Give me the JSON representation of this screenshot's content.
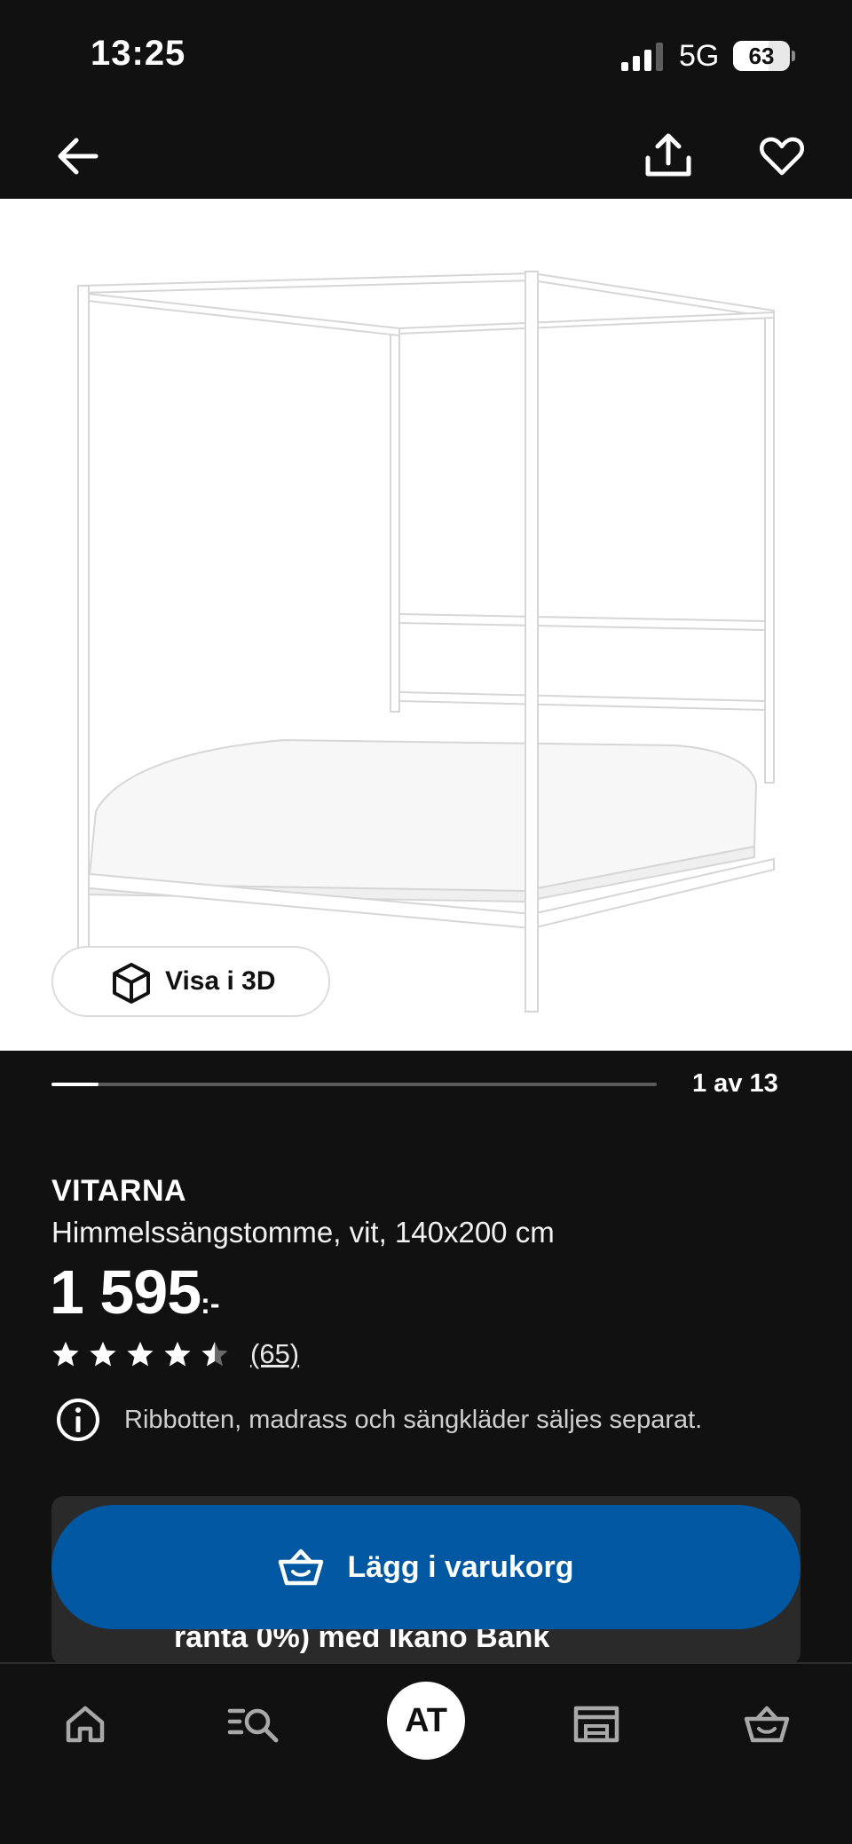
{
  "status_bar": {
    "time": "13:25",
    "network": "5G",
    "battery": "63",
    "battery_level": 0.63
  },
  "top_nav": {
    "back_icon": "arrow-left-icon",
    "share_icon": "share-icon",
    "favorite_icon": "heart-icon"
  },
  "gallery": {
    "view_3d_label": "Visa i 3D",
    "counter": "1 av 13",
    "progress": 0.077
  },
  "product": {
    "name": "VITARNA",
    "description": "Himmelssängstomme, vit, 140x200 cm",
    "price": "1 595",
    "price_suffix": ":-",
    "rating": 4.5,
    "review_count": "(65)",
    "info": "Ribbotten, madrass och sängkläder säljes separat."
  },
  "finance": {
    "text": "ränta 0%) med Ikano Bank"
  },
  "cart_button": {
    "label": "Lägg i varukorg"
  },
  "tab_bar": {
    "items": [
      {
        "name": "home",
        "icon": "home-icon"
      },
      {
        "name": "search",
        "icon": "search-list-icon"
      },
      {
        "name": "profile",
        "label": "AT"
      },
      {
        "name": "store",
        "icon": "store-icon"
      },
      {
        "name": "cart",
        "icon": "cart-icon"
      }
    ]
  },
  "colors": {
    "background": "#111111",
    "accent_blue": "#0058a3",
    "card": "#2a2a2a"
  }
}
